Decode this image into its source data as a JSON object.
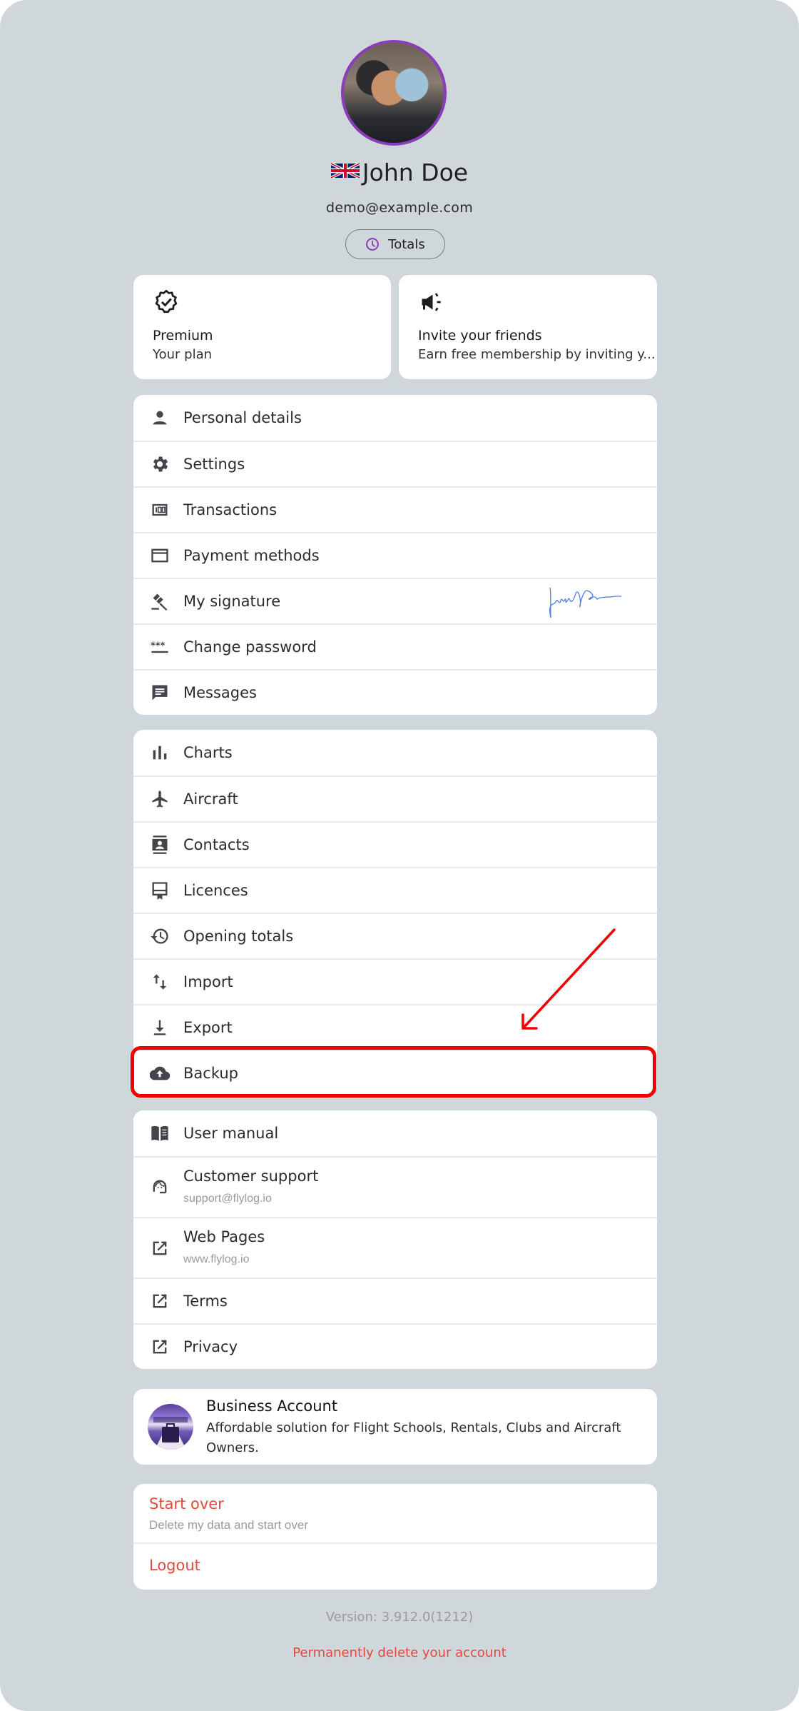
{
  "profile": {
    "name": "John Doe",
    "email": "demo@example.com",
    "flag": "uk-flag",
    "totals_label": "Totals",
    "accent_color": "#8a3db8"
  },
  "cards": [
    {
      "icon": "verified-badge-icon",
      "title": "Premium",
      "subtitle": "Your plan"
    },
    {
      "icon": "campaign-megaphone-icon",
      "title": "Invite your friends",
      "subtitle": "Earn free membership by inviting y..."
    }
  ],
  "menu_group_1": [
    {
      "icon": "person-icon",
      "label": "Personal details"
    },
    {
      "icon": "gear-icon",
      "label": "Settings"
    },
    {
      "icon": "counter-100-icon",
      "label": "Transactions"
    },
    {
      "icon": "credit-card-icon",
      "label": "Payment methods"
    },
    {
      "icon": "signature-icon",
      "label": "My signature"
    },
    {
      "icon": "password-icon",
      "label": "Change password"
    },
    {
      "icon": "message-icon",
      "label": "Messages"
    }
  ],
  "menu_group_2": [
    {
      "icon": "bar-chart-icon",
      "label": "Charts"
    },
    {
      "icon": "airplane-icon",
      "label": "Aircraft"
    },
    {
      "icon": "contacts-icon",
      "label": "Contacts"
    },
    {
      "icon": "license-icon",
      "label": "Licences"
    },
    {
      "icon": "history-icon",
      "label": "Opening totals"
    },
    {
      "icon": "import-arrows-icon",
      "label": "Import"
    },
    {
      "icon": "download-icon",
      "label": "Export"
    },
    {
      "icon": "cloud-upload-icon",
      "label": "Backup"
    }
  ],
  "menu_group_3": [
    {
      "icon": "book-icon",
      "label": "User manual"
    },
    {
      "icon": "support-agent-icon",
      "label": "Customer support",
      "sublabel": "support@flylog.io"
    },
    {
      "icon": "external-link-icon",
      "label": "Web Pages",
      "sublabel": "www.flylog.io"
    },
    {
      "icon": "external-link-icon",
      "label": "Terms"
    },
    {
      "icon": "external-link-icon",
      "label": "Privacy"
    }
  ],
  "business": {
    "title": "Business Account",
    "description": "Affordable solution for Flight Schools, Rentals, Clubs and Aircraft Owners."
  },
  "danger": {
    "start_over": "Start over",
    "start_over_sub": "Delete my data and start over",
    "logout": "Logout",
    "color": "#e04b3c"
  },
  "footer": {
    "version": "Version: 3.912.0(1212)",
    "delete_account": "Permanently delete your account"
  },
  "annotation": {
    "highlighted_item": "Backup",
    "color": "#f00000"
  }
}
